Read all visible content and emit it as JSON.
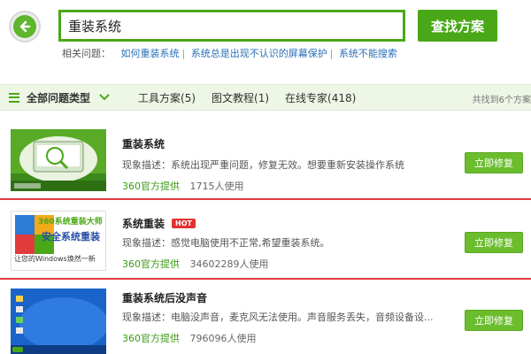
{
  "search": {
    "value": "重装系统",
    "button_label": "查找方案"
  },
  "related": {
    "label": "相关问题：",
    "links": [
      "如何重装系统",
      "系统总是出现不认识的屏幕保护",
      "系统不能搜索"
    ]
  },
  "filter": {
    "all_label": "全部问题类型",
    "tabs": [
      "工具方案(5)",
      "图文教程(1)",
      "在线专家(418)"
    ],
    "count_text": "共找到6个方案"
  },
  "results": [
    {
      "title": "重装系统",
      "desc": "现象描述：系统出现严重问题，修复无效。想要重新安装操作系统",
      "source": "360官方提供",
      "uses": "1715人使用",
      "button": "立即修复"
    },
    {
      "title": "系统重装",
      "hot": "HOT",
      "desc": "现象描述：感觉电脑使用不正常,希望重装系统。",
      "source": "360官方提供",
      "uses": "34602289人使用",
      "button": "立即修复",
      "thumb_text": {
        "brand": "360系统重装大师",
        "tagline": "安全系统重装",
        "slogan": "让您的Windows焕然一新"
      }
    },
    {
      "title": "重装系统后没声音",
      "desc": "现象描述：电脑没声音，麦克风无法使用。声音服务丢失，音频设备设...",
      "source": "360官方提供",
      "uses": "796096人使用",
      "button": "立即修复"
    }
  ],
  "colors": {
    "brand_green": "#4aa818",
    "button_green": "#6bbd2e",
    "divider_red": "#e23b3b",
    "link_blue": "#2a6fb8"
  }
}
